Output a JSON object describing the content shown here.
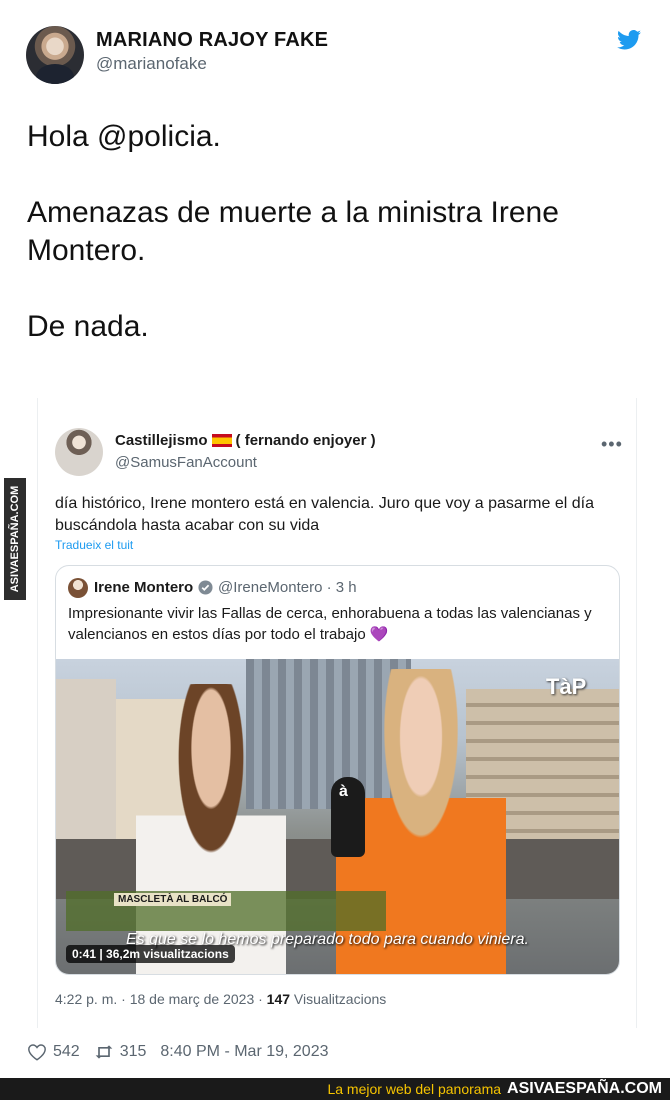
{
  "tweet": {
    "author_name": "MARIANO RAJOY FAKE",
    "author_handle": "@marianofake",
    "lines": [
      "Hola @policia.",
      "Amenazas de muerte a la ministra Irene Montero.",
      "De nada."
    ],
    "likes": "542",
    "retweets": "315",
    "timestamp": "8:40 PM - Mar 19, 2023"
  },
  "quoted": {
    "name_prefix": "Castillejismo",
    "name_suffix": "( fernando enjoyer )",
    "handle": "@SamusFanAccount",
    "text": "día histórico, Irene montero está en valencia. Juro que voy a pasarme el día buscándola hasta acabar con su vida",
    "translate": "Tradueix el tuit",
    "date": "4:22 p. m. · 18 de març de 2023 · ",
    "views_count": "147",
    "views_label": " Visualitzacions"
  },
  "nested": {
    "name": "Irene Montero",
    "handle": "@IreneMontero · 3 h",
    "text": "Impresionante vivir las Fallas de cerca, enhorabuena a todas las valencianas y valencianos en estos días por todo el trabajo",
    "heart": "💜",
    "video": {
      "logo": "TàP",
      "lower_third_title": "MASCLETÀ AL BALCÓ",
      "subtitle": "Es que se lo hemos preparado todo para cuando viniera.",
      "meta": "0:41 | 36,2m visualitzacions"
    }
  },
  "watermark": {
    "side": "ASIVAESPAÑA.COM",
    "slogan": "La mejor web del panorama",
    "brand": "ASIVAESPAÑA.COM"
  },
  "colors": {
    "twitter_blue": "#1d9bf0",
    "brand_yellow": "#f6c400"
  }
}
